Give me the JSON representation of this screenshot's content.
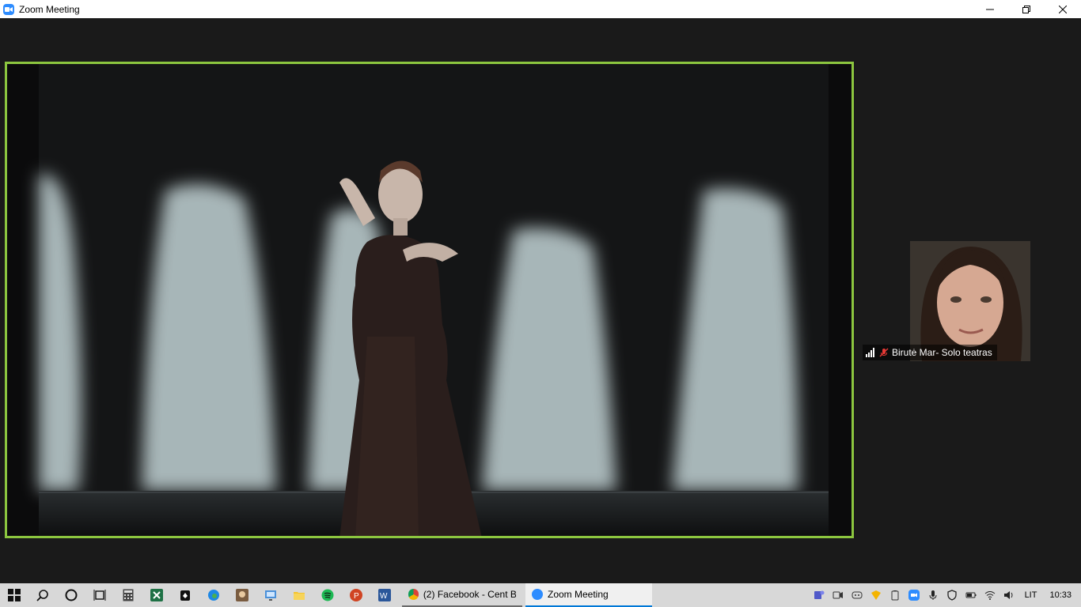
{
  "window": {
    "title": "Zoom Meeting",
    "controls": {
      "minimize": "minimize-icon",
      "restore": "restore-icon",
      "close": "close-icon"
    }
  },
  "meeting": {
    "active_speaker_border_color": "#8cc63f",
    "participants": [
      {
        "name": "Birutė Mar- Solo teatras",
        "muted": true,
        "connection": "good"
      }
    ]
  },
  "taskbar": {
    "pinned": [
      {
        "name": "start",
        "icon": "windows-icon"
      },
      {
        "name": "search",
        "icon": "search-icon"
      },
      {
        "name": "cortana",
        "icon": "cortana-circle-icon"
      },
      {
        "name": "task-view",
        "icon": "task-view-icon"
      },
      {
        "name": "calculator",
        "icon": "calculator-icon"
      },
      {
        "name": "excel",
        "icon": "excel-icon"
      },
      {
        "name": "solitaire",
        "icon": "cards-icon"
      },
      {
        "name": "edge",
        "icon": "edge-icon"
      },
      {
        "name": "photo-app",
        "icon": "photo-icon"
      },
      {
        "name": "control-panel",
        "icon": "monitor-icon"
      },
      {
        "name": "file-explorer",
        "icon": "folder-icon"
      },
      {
        "name": "spotify",
        "icon": "music-icon"
      },
      {
        "name": "powerpoint",
        "icon": "powerpoint-icon"
      },
      {
        "name": "word",
        "icon": "word-icon"
      }
    ],
    "apps": [
      {
        "label": "(2) Facebook - Cent B...",
        "icon": "chrome-icon",
        "state": "running"
      },
      {
        "label": "Zoom Meeting",
        "icon": "zoom-icon",
        "state": "active"
      }
    ],
    "tray": {
      "icons": [
        "teams-icon",
        "meet-icon",
        "discord-icon",
        "sticky-icon",
        "battery-save-icon",
        "zoom-tray-icon",
        "microphone-icon",
        "shield-icon",
        "power-icon",
        "wifi-icon",
        "volume-icon"
      ],
      "language": "LIT",
      "time": "10:33"
    }
  }
}
